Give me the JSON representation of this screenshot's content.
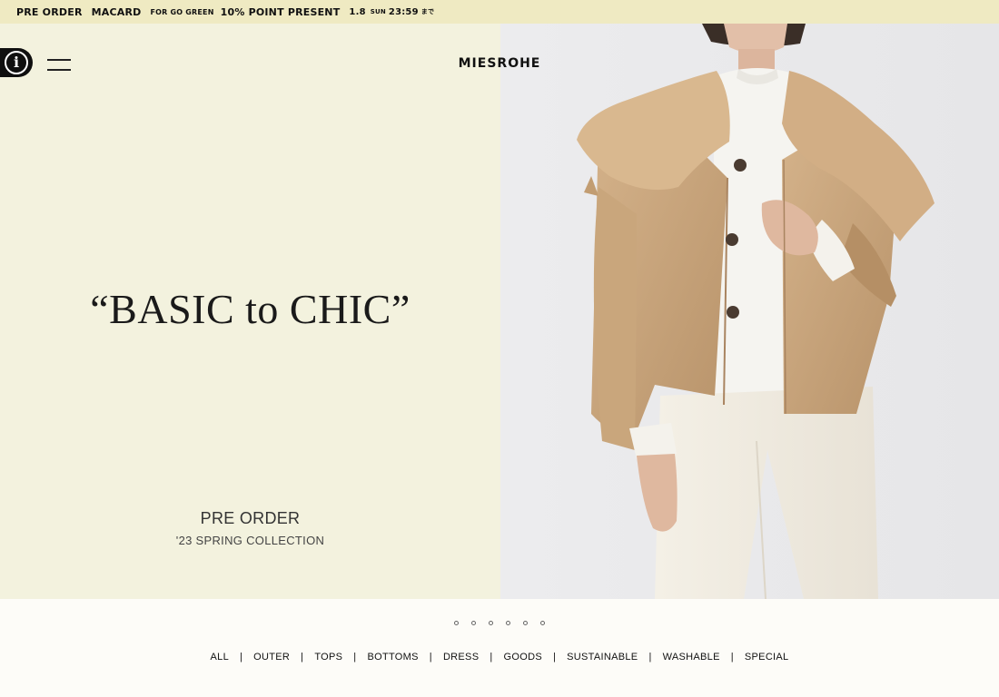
{
  "announcement": {
    "pre_order": "PRE ORDER",
    "macard": "MACARD",
    "go_green": "FOR GO GREEN",
    "point_present": "10% POINT PRESENT",
    "date": "1.8",
    "day": "SUN",
    "time": "23:59",
    "suffix": "まで"
  },
  "header": {
    "logo": "MIESROHE",
    "info_icon": "info-icon",
    "menu_icon": "hamburger-menu-icon"
  },
  "hero": {
    "headline": "“BASIC to CHIC”",
    "pre_title": "PRE ORDER",
    "pre_subtitle": "'23 SPRING COLLECTION",
    "left_bg": "#f3f2de",
    "right_bg": "#ebebed"
  },
  "carousel": {
    "slide_count": 6,
    "active_index": 0
  },
  "categories": [
    "ALL",
    "OUTER",
    "TOPS",
    "BOTTOMS",
    "DRESS",
    "GOODS",
    "SUSTAINABLE",
    "WASHABLE",
    "SPECIAL"
  ],
  "colors": {
    "announce_bg": "#efeac2",
    "coat": "#c9a77c",
    "text": "#111111"
  }
}
